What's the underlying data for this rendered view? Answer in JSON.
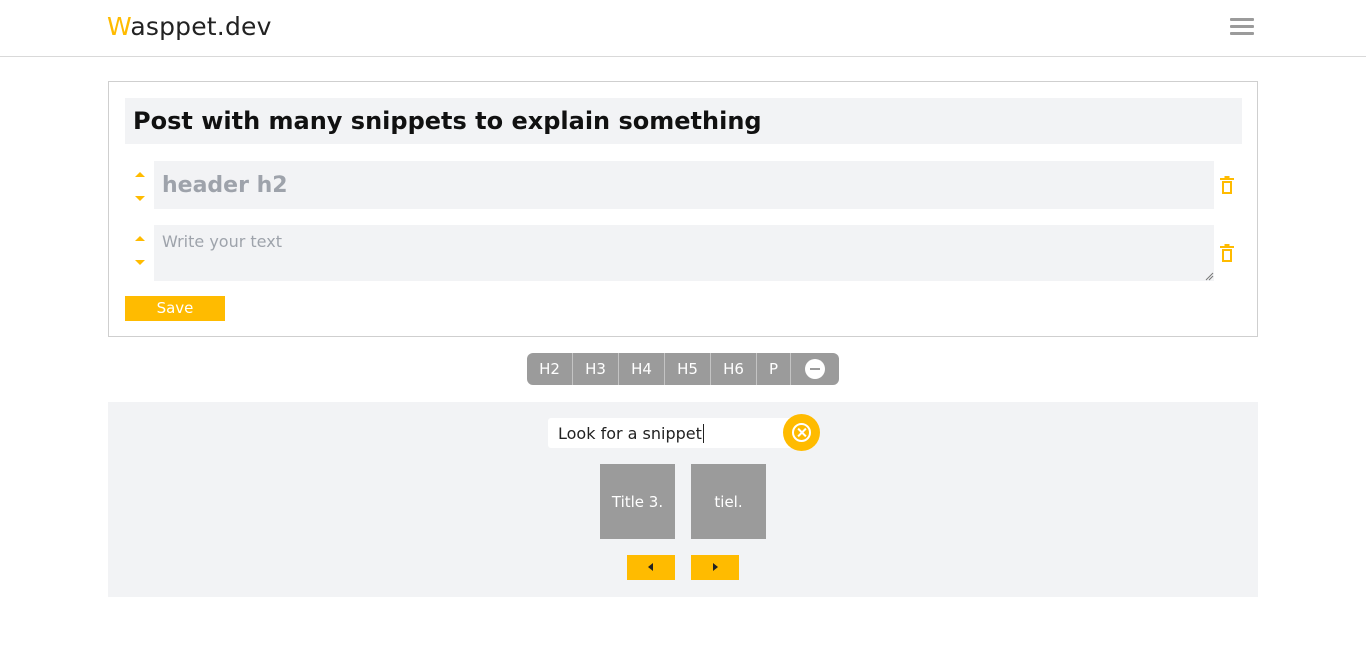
{
  "header": {
    "logo_first_letter": "W",
    "logo_rest": "asppet.dev",
    "menu_icon": "hamburger-menu-icon"
  },
  "editor": {
    "title": "Post with many snippets to explain something",
    "blocks": [
      {
        "type": "h2",
        "placeholder": "header h2",
        "value": ""
      },
      {
        "type": "p",
        "placeholder": "Write your text",
        "value": ""
      }
    ],
    "save_label": "Save",
    "move_up_icon": "caret-up-icon",
    "move_down_icon": "caret-down-icon",
    "delete_icon": "trash-icon"
  },
  "toolbar": {
    "buttons": [
      "H2",
      "H3",
      "H4",
      "H5",
      "H6",
      "P"
    ],
    "remove_icon": "minus-circle-icon"
  },
  "snippet_search": {
    "query": "Look for a snippet",
    "clear_icon": "close-circle-icon",
    "results": [
      "Title 3.",
      "tiel."
    ],
    "prev_icon": "triangle-left-icon",
    "next_icon": "triangle-right-icon"
  },
  "colors": {
    "accent": "#ffbb00",
    "gray_button": "#9b9b9b",
    "field_background": "#f2f3f5",
    "placeholder_text": "#9ea3ab"
  }
}
